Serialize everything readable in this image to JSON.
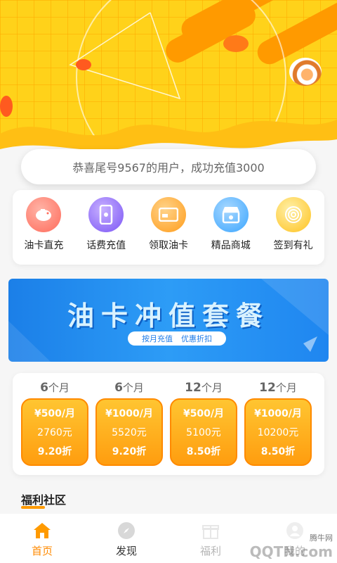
{
  "notice": {
    "text": "恭喜尾号9567的用户，成功充值3000"
  },
  "menu": {
    "items": [
      {
        "label": "油卡直充",
        "icon": "piggy-bank-icon",
        "color": "#ff6b5b"
      },
      {
        "label": "话费充值",
        "icon": "phone-icon",
        "color": "#8a63ff"
      },
      {
        "label": "领取油卡",
        "icon": "card-icon",
        "color": "#ffa723"
      },
      {
        "label": "精品商城",
        "icon": "shop-icon",
        "color": "#3aa5ff"
      },
      {
        "label": "签到有礼",
        "icon": "fingerprint-icon",
        "color": "#ffc21f"
      }
    ]
  },
  "banner": {
    "title": "油卡冲值套餐",
    "tag_left": "按月充值",
    "tag_right": "优惠折扣"
  },
  "packages": [
    {
      "num": "6",
      "unit": "个月",
      "per_month": "¥500/月",
      "total": "2760元",
      "discount": "9.20折"
    },
    {
      "num": "6",
      "unit": "个月",
      "per_month": "¥1000/月",
      "total": "5520元",
      "discount": "9.20折"
    },
    {
      "num": "12",
      "unit": "个月",
      "per_month": "¥500/月",
      "total": "5100元",
      "discount": "8.50折"
    },
    {
      "num": "12",
      "unit": "个月",
      "per_month": "¥1000/月",
      "total": "10200元",
      "discount": "8.50折"
    }
  ],
  "section": {
    "title": "福利社区"
  },
  "tabbar": {
    "tabs": [
      {
        "label": "首页",
        "icon": "home-icon",
        "active": true
      },
      {
        "label": "发现",
        "icon": "compass-icon",
        "active": false
      },
      {
        "label": "福利",
        "icon": "gift-icon",
        "active": false
      },
      {
        "label": "我的",
        "icon": "user-icon",
        "active": false
      }
    ]
  },
  "watermark": {
    "small": "腾牛网",
    "big": "QQTN.com"
  },
  "colors": {
    "accent": "#ff9a00",
    "hero_yellow": "#ffd21a",
    "banner_blue": "#1f86f0"
  }
}
